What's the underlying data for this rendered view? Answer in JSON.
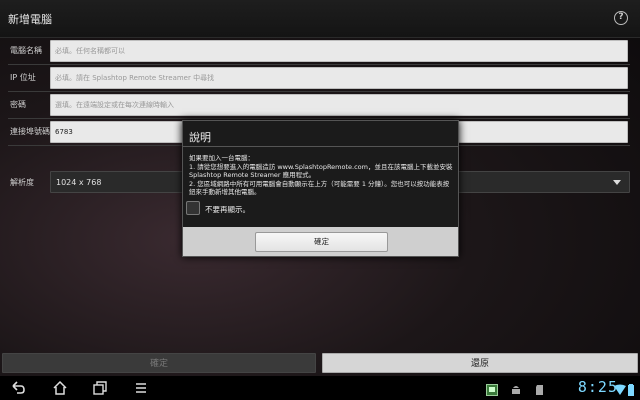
{
  "header": {
    "title": "新增電腦"
  },
  "form": {
    "name_label": "電腦名稱",
    "name_placeholder": "必填。任何名稱都可以",
    "ip_label": "IP 位址",
    "ip_placeholder": "必填。請在 Splashtop Remote Streamer 中尋找",
    "password_label": "密碼",
    "password_placeholder": "選填。在遠端設定或在每次連線時輸入",
    "port_label": "連接埠號碼",
    "port_value": "6783",
    "resolution_label": "解析度",
    "resolution_value": "1024 x 768"
  },
  "buttons": {
    "ok": "確定",
    "restore": "還原"
  },
  "dialog": {
    "title": "說明",
    "line1": "如果要加入一台電腦：",
    "line2": "1. 請從您想要進入的電腦造訪 www.SplashtopRemote.com，並且在該電腦上下載並安裝 Splashtop Remote Streamer 應用程式。",
    "line3": "2. 您區域網路中所有可用電腦會自動顯示在上方（可能需要 1 分鐘）。您也可以按功能表按鈕來手動新增其他電腦。",
    "checkbox_label": "不要再顯示。",
    "ok_label": "確定"
  },
  "status_bar": {
    "clock": "8:25"
  },
  "colors": {
    "clock": "#7dd8ff",
    "dialog_bg": "#1b1b1b",
    "field_bg": "#e9e9e9"
  }
}
